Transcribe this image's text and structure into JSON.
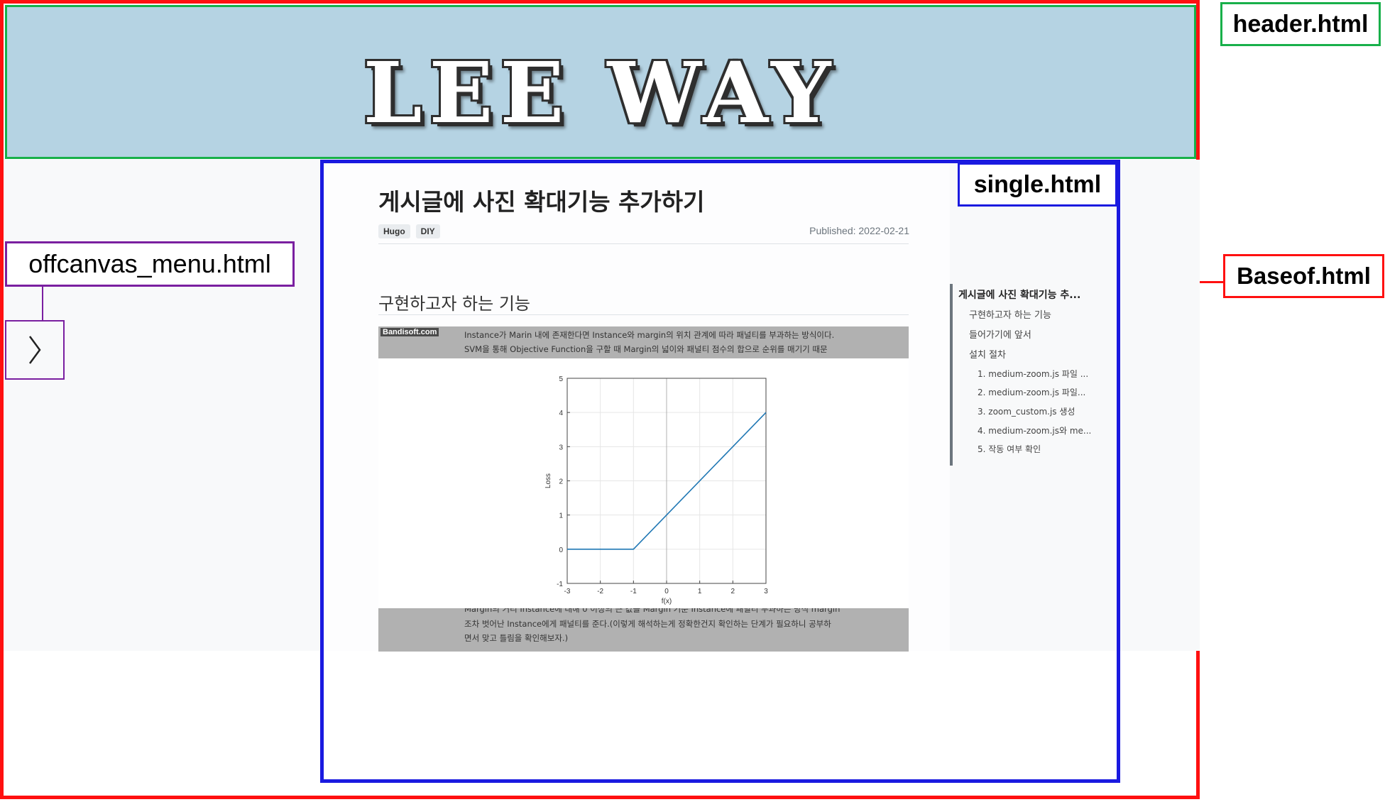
{
  "header": {
    "logo_text": "LEE WAY"
  },
  "labels": {
    "header": "header.html",
    "single": "single.html",
    "baseof": "Baseof.html",
    "offcanvas": "offcanvas_menu.html"
  },
  "offcanvas": {
    "toggle_glyph": "〉"
  },
  "post": {
    "title": "게시글에 사진 확대기능 추가하기",
    "tags": [
      "Hugo",
      "DIY"
    ],
    "published": "Published: 2022-02-21",
    "section_heading": "구현하고자 하는 기능"
  },
  "screenshot": {
    "watermark": "Bandisoft.com",
    "top_lines": [
      "Instance가 Marin 내에 존재한다면 Instance와 margin의 위치 관계에 따라 패널티를 부과하는 방식이다.",
      "SVM을 통해 Objective Function을 구할 때 Margin의 넓이와 패널티 점수의 합으로 순위를 매기기 때문"
    ],
    "bottom_lines": [
      "Margin의 거리 Instance에 대해 0 이상의 큰 값을 Margin 기준 Instance에 패널티 부과하는 방식 margin",
      "조차 벗어난 Instance에게 패널티를 준다.(이렇게 해석하는게 정확한건지 확인하는 단계가 필요하니 공부하",
      "면서 맞고 틀림을 확인해보자.)"
    ]
  },
  "chart_data": {
    "type": "line",
    "title": "",
    "xlabel": "f(x)",
    "ylabel": "Loss",
    "xlim": [
      -3,
      3
    ],
    "ylim": [
      -1,
      5
    ],
    "xticks": [
      -3,
      -2,
      -1,
      0,
      1,
      2,
      3
    ],
    "yticks": [
      -1,
      0,
      1,
      2,
      3,
      4,
      5
    ],
    "grid": true,
    "series": [
      {
        "x": [
          -3,
          -1,
          3
        ],
        "y": [
          0,
          0,
          4
        ],
        "color": "#1f77b4"
      }
    ]
  },
  "toc": {
    "items": [
      {
        "level": 1,
        "label": "게시글에 사진 확대기능 추..."
      },
      {
        "level": 2,
        "label": "구현하고자 하는 기능"
      },
      {
        "level": 2,
        "label": "들어가기에 앞서"
      },
      {
        "level": 2,
        "label": "설치 절차"
      },
      {
        "level": 3,
        "label": "1. medium-zoom.js 파일 ..."
      },
      {
        "level": 3,
        "label": "2. medium-zoom.js 파일..."
      },
      {
        "level": 3,
        "label": "3. zoom_custom.js 생성"
      },
      {
        "level": 3,
        "label": "4. medium-zoom.js와 me..."
      },
      {
        "level": 3,
        "label": "5. 작동 여부 확인"
      }
    ]
  },
  "colors": {
    "header_bg": "#b5d3e3",
    "baseof_border": "#ff1010",
    "header_border": "#18b04a",
    "single_border": "#1a1ae0",
    "offcanvas_border": "#7a1fa0"
  }
}
